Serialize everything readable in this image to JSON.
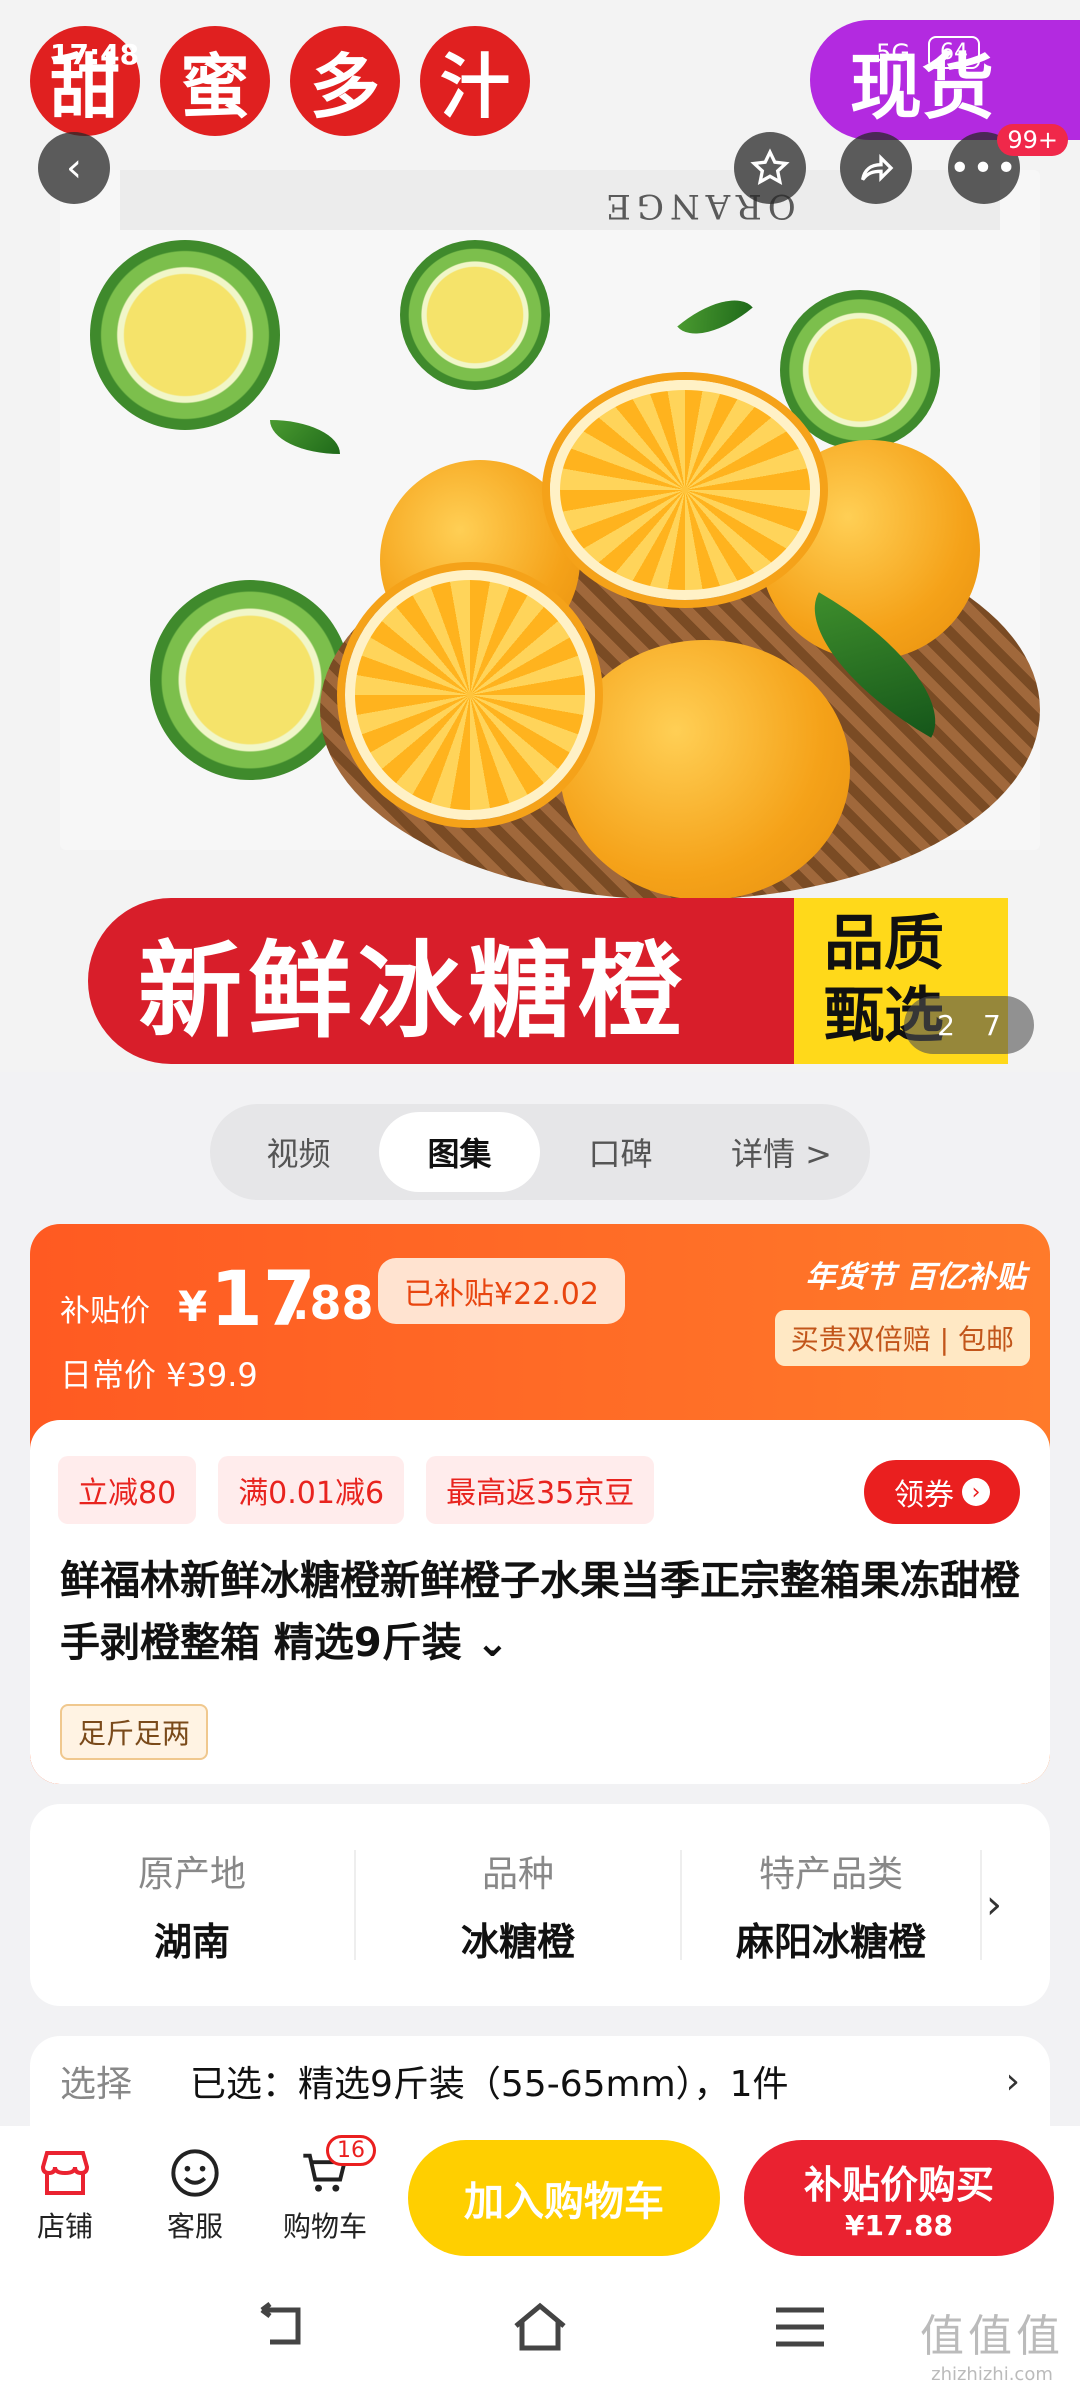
{
  "status_bar": {
    "time": "17:48",
    "network": "5G",
    "battery": "64"
  },
  "hero": {
    "overlay_chars": [
      "甜",
      "蜜",
      "多",
      "汁"
    ],
    "spot_badge": "现货",
    "box_text": "ORANGE",
    "banner_text": "新鲜冰糖橙",
    "banner_tag": [
      "品质",
      "甄选"
    ],
    "image_index": "2",
    "image_total": "7",
    "notification_count": "99+"
  },
  "media_tabs": [
    "视频",
    "图集",
    "口碑",
    "详情 >"
  ],
  "price": {
    "label": "补贴价",
    "yen": "¥",
    "integer": "17",
    "decimal": ".88",
    "subsidy_tag": "已补贴¥22.02",
    "daily_label": "日常价 ¥39.9",
    "promo_logo": "年货节 百亿补贴",
    "promo_tag": "买贵双倍赔 | 包邮"
  },
  "coupons": [
    "立减80",
    "满0.01减6",
    "最高返35京豆"
  ],
  "get_coupon": "领券",
  "product_title": "鲜福林新鲜冰糖橙新鲜橙子水果当季正宗整箱果冻甜橙手剥橙整箱 精选9斤装 ⌄",
  "weight_tag": "足斤足两",
  "attributes": [
    {
      "key": "原产地",
      "value": "湖南"
    },
    {
      "key": "品种",
      "value": "冰糖橙"
    },
    {
      "key": "特产品类",
      "value": "麻阳冰糖橙"
    }
  ],
  "selection": {
    "label": "选择",
    "value": "已选：精选9斤装（55-65mm），1件"
  },
  "bottom_bar": {
    "store": "店铺",
    "service": "客服",
    "cart": "购物车",
    "cart_count": "16",
    "add_to_cart": "加入购物车",
    "buy_title": "补贴价购买",
    "buy_price": "¥17.88"
  },
  "watermark": {
    "line1": "值值值",
    "line2": "zhizhizhi.com"
  },
  "colors": {
    "accent_red": "#ea2230",
    "accent_orange": "#ff5a22",
    "yellow": "#ffcf00"
  }
}
